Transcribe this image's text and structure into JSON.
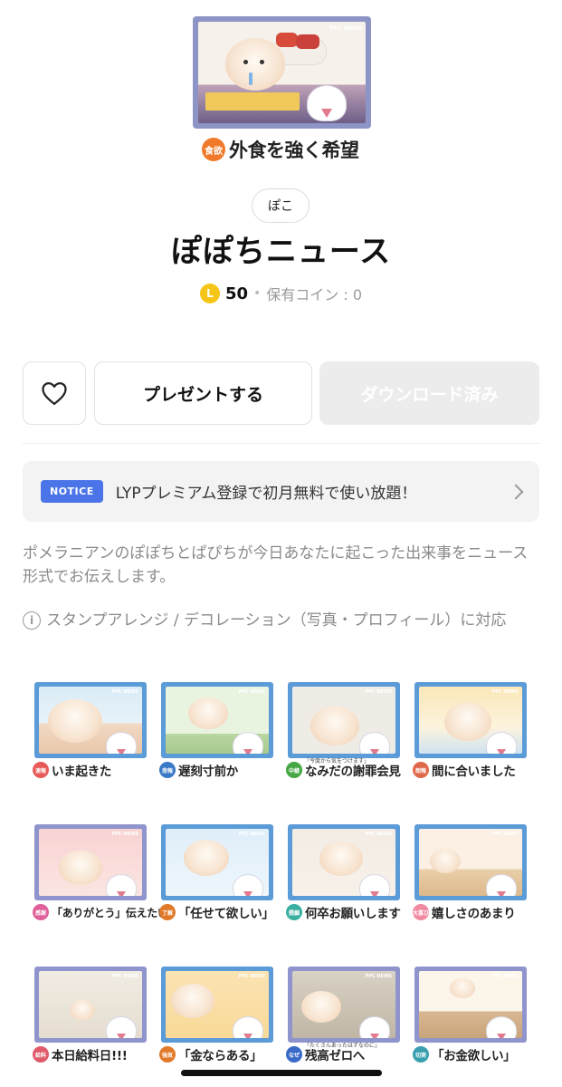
{
  "hero": {
    "badge": "食欲",
    "caption": "外食を強く希望",
    "news_mark": "PPC NEWS"
  },
  "author": "ぽこ",
  "title": "ぽぽちニュース",
  "price": {
    "coin_symbol": "L",
    "amount": "50",
    "separator": "•",
    "owned": "保有コイン : 0"
  },
  "actions": {
    "like_icon": "heart-outline-icon",
    "gift_label": "プレゼントする",
    "download_label": "ダウンロード済み"
  },
  "notice": {
    "badge": "NOTICE",
    "text": "LYPプレミアム登録で初月無料で使い放題！",
    "chevron_icon": "chevron-right-icon"
  },
  "description": "ポメラニアンのぽぽちとぱぴちが今日あなたに起こった出来事をニュース形式でお伝えします。",
  "arrange": {
    "info_icon": "info-circle-icon",
    "text": "スタンプアレンジ / デコレーション（写真・プロフィール）に対応"
  },
  "stickers": [
    {
      "badge": "速報",
      "badge_color": "#e85a5a",
      "caption": "いま起きた",
      "sub": "",
      "frame": "blue"
    },
    {
      "badge": "悲報",
      "badge_color": "#3a78c8",
      "caption": "遅刻寸前か",
      "sub": "",
      "frame": "blue"
    },
    {
      "badge": "中継",
      "badge_color": "#45a845",
      "caption": "なみだの謝罪会見",
      "sub": "「今度から気をつけます」",
      "frame": "blue"
    },
    {
      "badge": "朗報",
      "badge_color": "#e0684a",
      "caption": "間に合いました",
      "sub": "",
      "frame": "blue"
    },
    {
      "badge": "感謝",
      "badge_color": "#e0609a",
      "caption": "「ありがとう」伝えたい",
      "sub": "",
      "frame": "purple"
    },
    {
      "badge": "了解",
      "badge_color": "#e07a2a",
      "caption": "「任せて欲しい」",
      "sub": "",
      "frame": "blue"
    },
    {
      "badge": "懇願",
      "badge_color": "#3ab0a0",
      "caption": "何卒お願いします",
      "sub": "",
      "frame": "blue"
    },
    {
      "badge": "大喜び",
      "badge_color": "#f08aa0",
      "caption": "嬉しさのあまり",
      "sub": "",
      "frame": "blue"
    },
    {
      "badge": "給料",
      "badge_color": "#e05a6a",
      "caption": "本日給料日!!!",
      "sub": "",
      "frame": "purple"
    },
    {
      "badge": "強気",
      "badge_color": "#e07a2a",
      "caption": "「金ならある」",
      "sub": "",
      "frame": "blue"
    },
    {
      "badge": "なぜ",
      "badge_color": "#3a6ac8",
      "caption": "残高ゼロへ",
      "sub": "「たくさんあったはずなのに」",
      "frame": "purple"
    },
    {
      "badge": "切実",
      "badge_color": "#3aa0b0",
      "caption": "「お金欲しい」",
      "sub": "",
      "frame": "purple"
    }
  ]
}
